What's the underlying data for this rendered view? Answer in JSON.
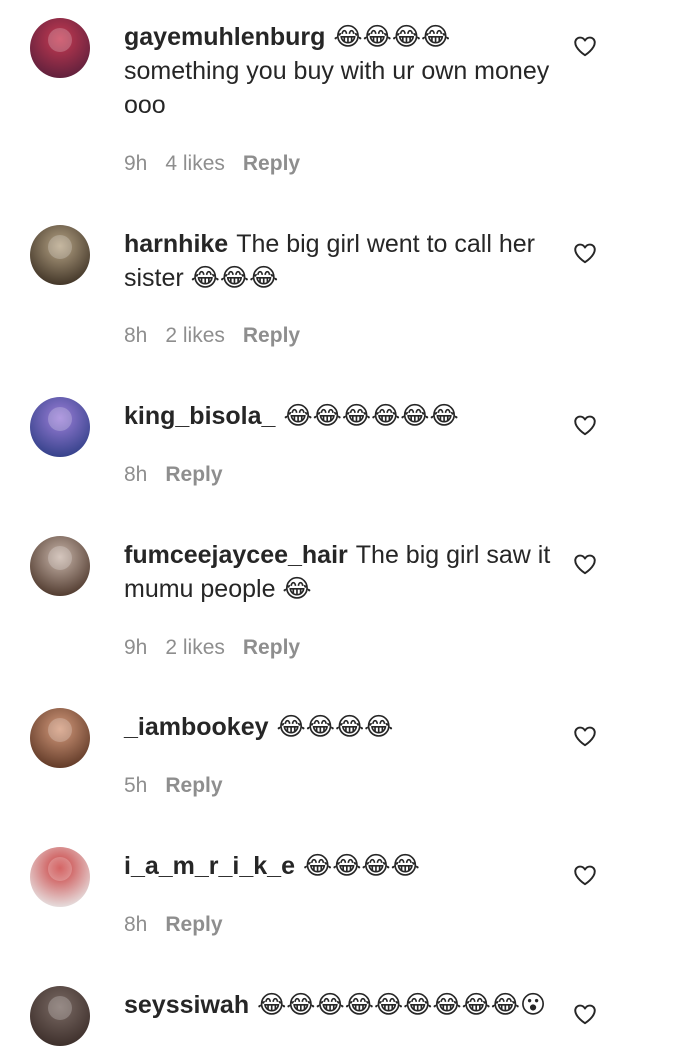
{
  "comments": [
    {
      "username": "gayemuhlenburg",
      "text": "😂😂😂😂 something you buy with ur own money ooo",
      "time": "9h",
      "likes": "4 likes",
      "reply": "Reply",
      "avatar_colors": [
        "#c63a52",
        "#5a1f3b"
      ]
    },
    {
      "username": "harnhike",
      "text": "The big girl went to call her sister 😂😂😂",
      "time": "8h",
      "likes": "2 likes",
      "reply": "Reply",
      "avatar_colors": [
        "#b6a486",
        "#3b2f22"
      ]
    },
    {
      "username": "king_bisola_",
      "text": "😂😂😂😂😂😂",
      "time": "8h",
      "likes": "",
      "reply": "Reply",
      "avatar_colors": [
        "#9c7fd8",
        "#2f3e86"
      ]
    },
    {
      "username": "fumceejaycee_hair",
      "text": "The big girl saw it mumu people 😂",
      "time": "9h",
      "likes": "2 likes",
      "reply": "Reply",
      "avatar_colors": [
        "#c9b6ab",
        "#4a3428"
      ]
    },
    {
      "username": "_iambookey",
      "text": "😂😂😂😂",
      "time": "5h",
      "likes": "",
      "reply": "Reply",
      "avatar_colors": [
        "#d49a7c",
        "#5b3523"
      ]
    },
    {
      "username": "i_a_m_r_i_k_e",
      "text": "😂😂😂😂",
      "time": "8h",
      "likes": "",
      "reply": "Reply",
      "avatar_colors": [
        "#c93a3a",
        "#e8e8e8"
      ]
    },
    {
      "username": "seyssiwah",
      "text": "😂😂😂😂😂😂😂😂😂😮",
      "time": "",
      "likes": "",
      "reply": "",
      "avatar_colors": [
        "#7a6a64",
        "#3a2c28"
      ]
    }
  ],
  "colors": {
    "text": "#262626",
    "secondary": "#8e8e8e",
    "background": "#ffffff"
  },
  "icons": {
    "like": "heart-outline-icon"
  }
}
